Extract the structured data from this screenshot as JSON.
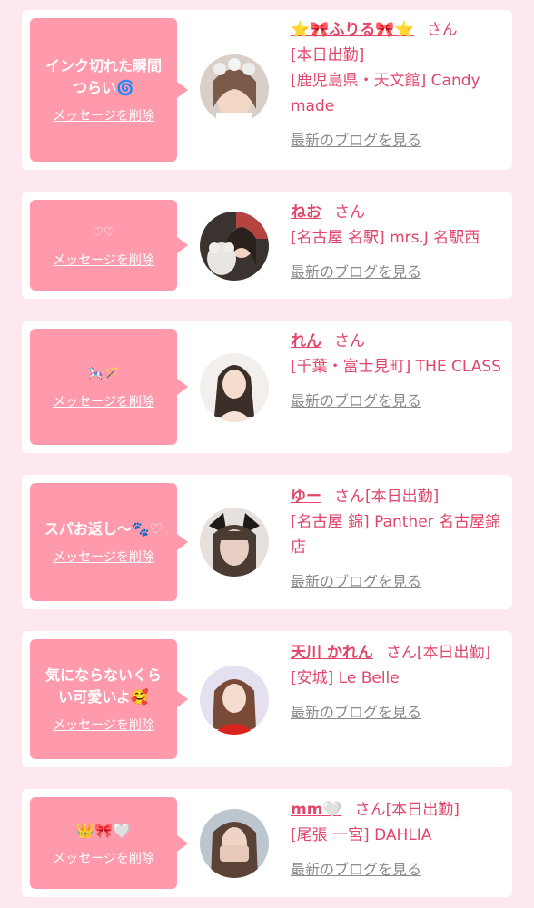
{
  "common": {
    "delete_label": "メッセージを削除",
    "san": "さん",
    "blog_label": "最新のブログを見る",
    "bubble_color": "#fe9aab",
    "accent_color": "#e0476a",
    "page_bg": "#fde8ef"
  },
  "cards": [
    {
      "message": "インク切れた瞬間\nつらい🌀",
      "name": "⭐🎀ふりる🎀⭐",
      "name_suffix": "",
      "line1": "[本日出勤]",
      "line2": "[鹿児島県・天文館] Candy made"
    },
    {
      "message": "♡♡",
      "name": "ねお",
      "name_suffix": "",
      "line1": "[名古屋 名駅] mrs.J 名駅西",
      "line2": ""
    },
    {
      "message": "🎠🪄",
      "name": "れん",
      "name_suffix": "",
      "line1": "[千葉・富士見町] THE CLASS",
      "line2": ""
    },
    {
      "message": "スパお返し〜🐾♡",
      "name": "ゆー",
      "name_suffix": "[本日出勤]",
      "line1": "[名古屋 錦] Panther 名古屋錦店",
      "line2": ""
    },
    {
      "message": "気にならないくら\nい可愛いよ🥰",
      "name": "天川 かれん",
      "name_suffix": "[本日出勤]",
      "line1": "[安城] Le Belle",
      "line2": ""
    },
    {
      "message": "👑🎀🤍",
      "name": "mm🤍",
      "name_suffix": "[本日出勤]",
      "line1": "[尾張 一宮] DAHLIA",
      "line2": ""
    }
  ]
}
